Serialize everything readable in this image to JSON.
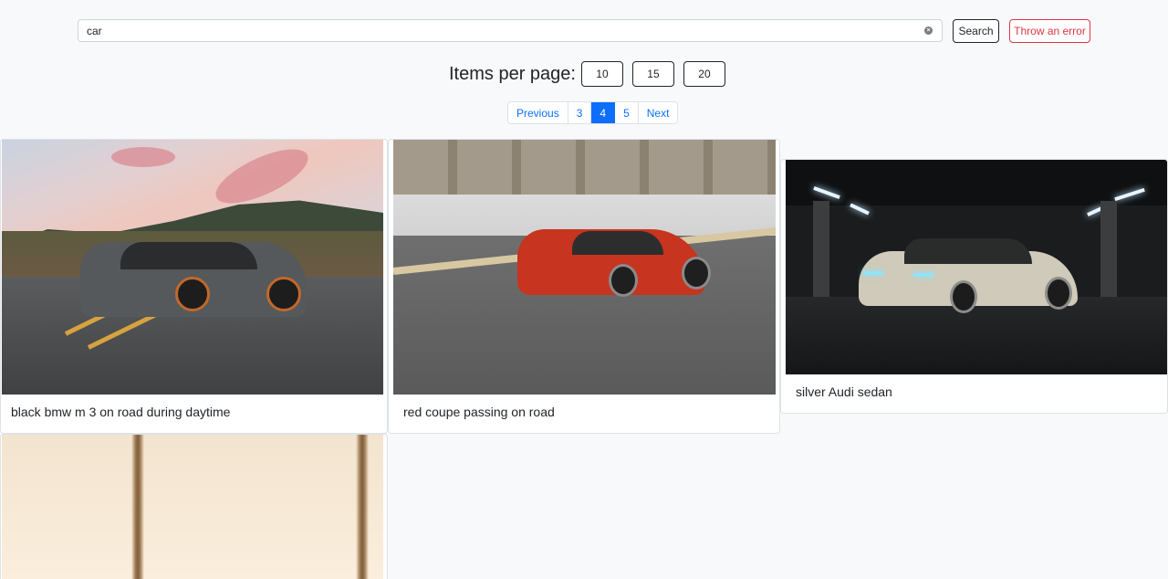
{
  "search": {
    "value": "car",
    "placeholder": "",
    "search_label": "Search",
    "error_label": "Throw an error"
  },
  "items_per_page": {
    "label": "Items per page:",
    "options": [
      "10",
      "15",
      "20"
    ]
  },
  "pagination": {
    "previous": "Previous",
    "pages": [
      "3",
      "4",
      "5"
    ],
    "current": "4",
    "next": "Next"
  },
  "results": [
    {
      "title": "black bmw m 3 on road during daytime"
    },
    {
      "title": "red coupe passing on road"
    },
    {
      "title": "silver Audi sedan"
    },
    {
      "title": ""
    }
  ],
  "colors": {
    "primary": "#0d6efd",
    "danger": "#dc3545",
    "background": "#f8f9fa"
  }
}
